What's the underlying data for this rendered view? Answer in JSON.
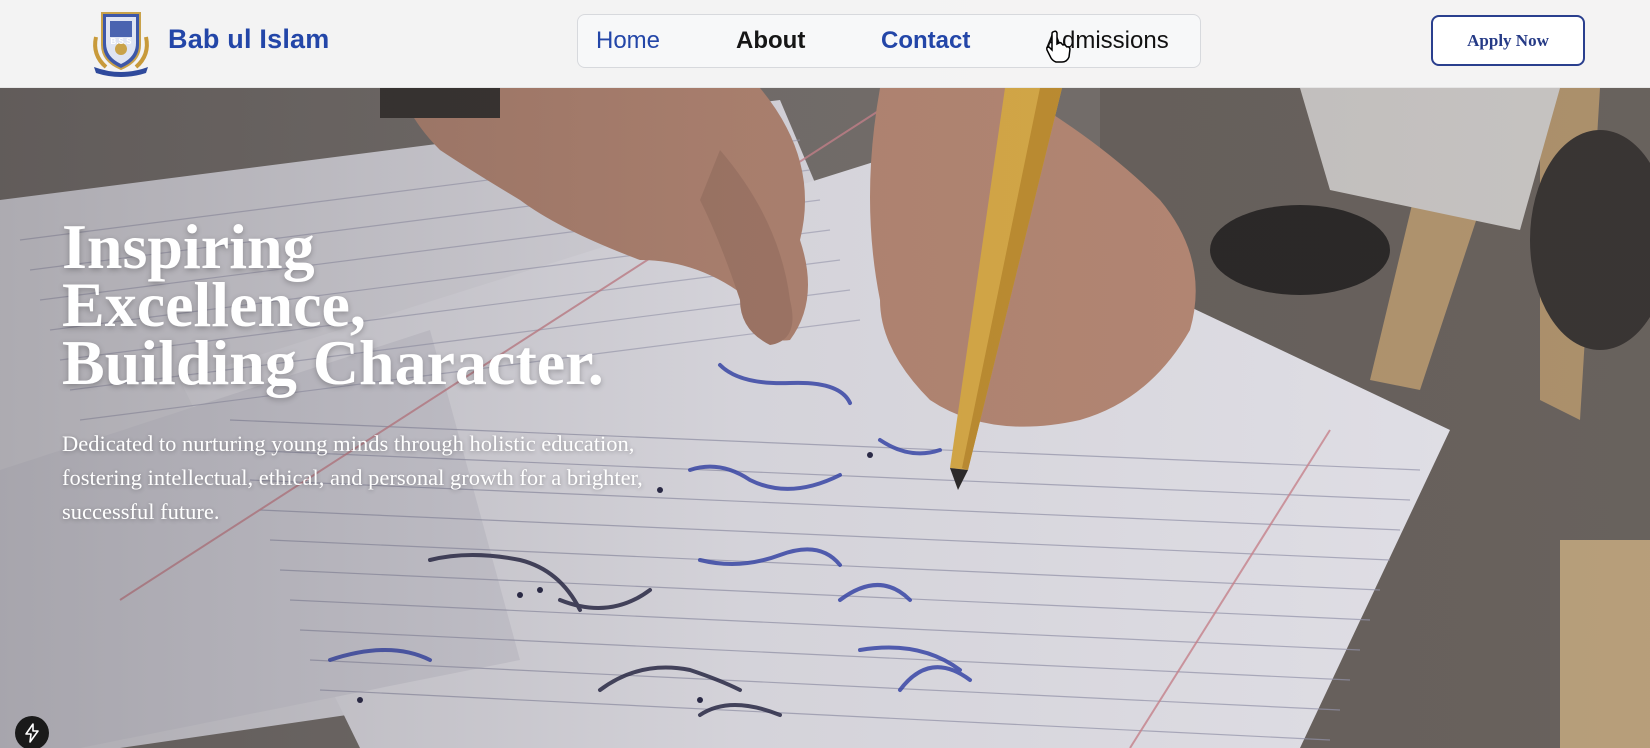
{
  "header": {
    "brand": "Bab ul Islam",
    "logo_text": "B.S.S",
    "nav": {
      "home": "Home",
      "about": "About",
      "contact": "Contact",
      "admissions": "Admissions"
    },
    "apply_label": "Apply Now"
  },
  "hero": {
    "title_line1": "Inspiring",
    "title_line2": "Excellence,",
    "title_line3": "Building Character.",
    "subtitle": "Dedicated to nurturing young minds through holistic education, fostering intellectual, ethical, and personal growth for a brighter, successful future.",
    "background_icon": "notebook-handwriting-photo"
  },
  "colors": {
    "brand_blue": "#2346a8",
    "button_border": "#2a3f8e",
    "navbar_bg": "#f8f8f8"
  },
  "floating": {
    "icon": "lightning-bolt-icon"
  }
}
